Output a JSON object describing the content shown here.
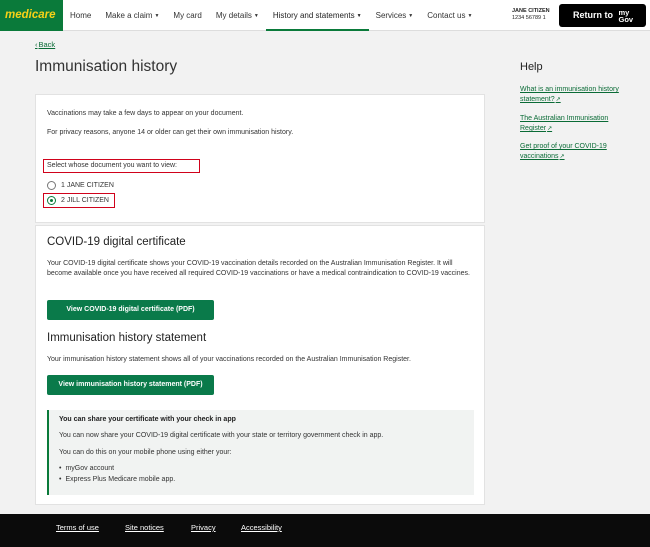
{
  "header": {
    "logo": "medicare",
    "nav": [
      {
        "label": "Home",
        "caret": false
      },
      {
        "label": "Make a claim",
        "caret": true
      },
      {
        "label": "My card",
        "caret": false
      },
      {
        "label": "My details",
        "caret": true
      },
      {
        "label": "History and statements",
        "caret": true
      },
      {
        "label": "Services",
        "caret": true
      },
      {
        "label": "Contact us",
        "caret": true
      }
    ],
    "active_nav": "History and statements",
    "user_name": "JANE CITIZEN",
    "user_number": "1234 56789 1",
    "return_label": "Return to",
    "mygov_my": "my",
    "mygov_gov": "Gov"
  },
  "back": "Back",
  "page_title": "Immunisation history",
  "intro": {
    "line1": "Vaccinations may take a few days to appear on your document.",
    "line2": "For privacy reasons, anyone 14 or older can get their own immunisation history."
  },
  "select_label": "Select whose document you want to view:",
  "people": [
    {
      "label": "1 JANE CITIZEN",
      "selected": false
    },
    {
      "label": "2 JILL CITIZEN",
      "selected": true
    }
  ],
  "covid": {
    "heading": "COVID-19 digital certificate",
    "body": "Your COVID-19 digital certificate shows your COVID-19 vaccination details recorded on the Australian Immunisation Register. It will become available once you have received all required COVID-19 vaccinations or have a medical contraindication to COVID-19 vaccines.",
    "button": "View COVID-19 digital certificate (PDF)"
  },
  "statement": {
    "heading": "Immunisation history statement",
    "body": "Your immunisation history statement shows all of your vaccinations recorded on the Australian Immunisation Register.",
    "button": "View immunisation history statement (PDF)"
  },
  "share": {
    "title": "You can share your certificate with your check in app",
    "line1": "You can now share your COVID-19 digital certificate with your state or territory government check in app.",
    "line2": "You can do this on your mobile phone using either your:",
    "items": [
      "myGov account",
      "Express Plus Medicare mobile app."
    ]
  },
  "help": {
    "title": "Help",
    "links": [
      "What is an immunisation history statement?",
      "The Australian Immunisation Register",
      "Get proof of your COVID-19 vaccinations"
    ]
  },
  "footer": {
    "links": [
      "Terms of use",
      "Site notices",
      "Privacy",
      "Accessibility"
    ]
  },
  "colors": {
    "brand_green": "#0a7a3a",
    "logo_yellow": "#f7d117",
    "highlight_red": "#d0021b"
  }
}
